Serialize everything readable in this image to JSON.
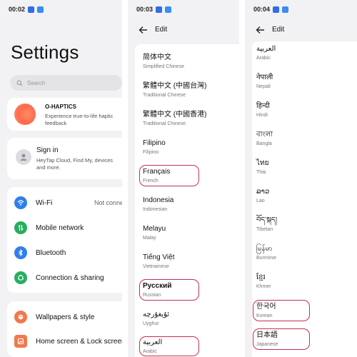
{
  "screen1": {
    "time": "00:02",
    "title": "Settings",
    "search_placeholder": "Search",
    "haptics": {
      "title": "O-HAPTICS",
      "desc": "Experience true-to-life haptic feedback"
    },
    "account": {
      "title": "Sign in",
      "desc": "HeyTap Cloud, Find My, devices and more."
    },
    "rows": [
      {
        "label": "Wi-Fi",
        "value": "Not conne",
        "icon": "wifi-icon",
        "color": "#2f80ed"
      },
      {
        "label": "Mobile network",
        "value": "",
        "icon": "mobile-network-icon",
        "color": "#27ae60"
      },
      {
        "label": "Bluetooth",
        "value": "",
        "icon": "bluetooth-icon",
        "color": "#2f80ed"
      },
      {
        "label": "Connection & sharing",
        "value": "",
        "icon": "connection-sharing-icon",
        "color": "#27ae60"
      }
    ],
    "rows2": [
      {
        "label": "Wallpapers & style",
        "icon": "wallpaper-icon",
        "color": "#f2784b"
      },
      {
        "label": "Home screen & Lock screen",
        "icon": "home-screen-icon",
        "color": "#f2784b"
      }
    ]
  },
  "screen2": {
    "time": "00:03",
    "header": "Edit",
    "languages": [
      {
        "native": "简体中文",
        "english": "Simplified Chinese",
        "highlighted": false
      },
      {
        "native": "繁體中文 (中國台灣)",
        "english": "Traditional Chinese",
        "highlighted": false
      },
      {
        "native": "繁體中文 (中國香港)",
        "english": "Traditional Chinese",
        "highlighted": false
      },
      {
        "native": "Filipino",
        "english": "Filipino",
        "highlighted": false
      },
      {
        "native": "Français",
        "english": "French",
        "highlighted": true
      },
      {
        "native": "Indonesia",
        "english": "Indonesian",
        "highlighted": false
      },
      {
        "native": "Melayu",
        "english": "Malay",
        "highlighted": false
      },
      {
        "native": "Tiếng Việt",
        "english": "Vietnamese",
        "highlighted": false
      },
      {
        "native": "Русский",
        "english": "Russian",
        "highlighted": true
      },
      {
        "native": "ئۇيغۇرچە",
        "english": "Uyghur",
        "highlighted": false
      },
      {
        "native": "العربية",
        "english": "Arabic",
        "highlighted": true
      }
    ]
  },
  "screen3": {
    "time": "00:04",
    "header": "Edit",
    "languages": [
      {
        "native": "العربية",
        "english": "Arabic",
        "highlighted": false
      },
      {
        "native": "नेपाली",
        "english": "Nepali",
        "highlighted": false
      },
      {
        "native": "हिन्दी",
        "english": "Hindi",
        "highlighted": false
      },
      {
        "native": "বাংলা",
        "english": "Bangla",
        "highlighted": false
      },
      {
        "native": "ไทย",
        "english": "Thai",
        "highlighted": false
      },
      {
        "native": "ລາວ",
        "english": "Lao",
        "highlighted": false
      },
      {
        "native": "བོད་སྐད།",
        "english": "Tibetan",
        "highlighted": false
      },
      {
        "native": "မြန်မာ",
        "english": "Burmese",
        "highlighted": false
      },
      {
        "native": "ខ្មែរ",
        "english": "Khmer",
        "highlighted": false
      },
      {
        "native": "한국어",
        "english": "Korean",
        "highlighted": true
      },
      {
        "native": "日本語",
        "english": "Japanese",
        "highlighted": true
      }
    ]
  }
}
